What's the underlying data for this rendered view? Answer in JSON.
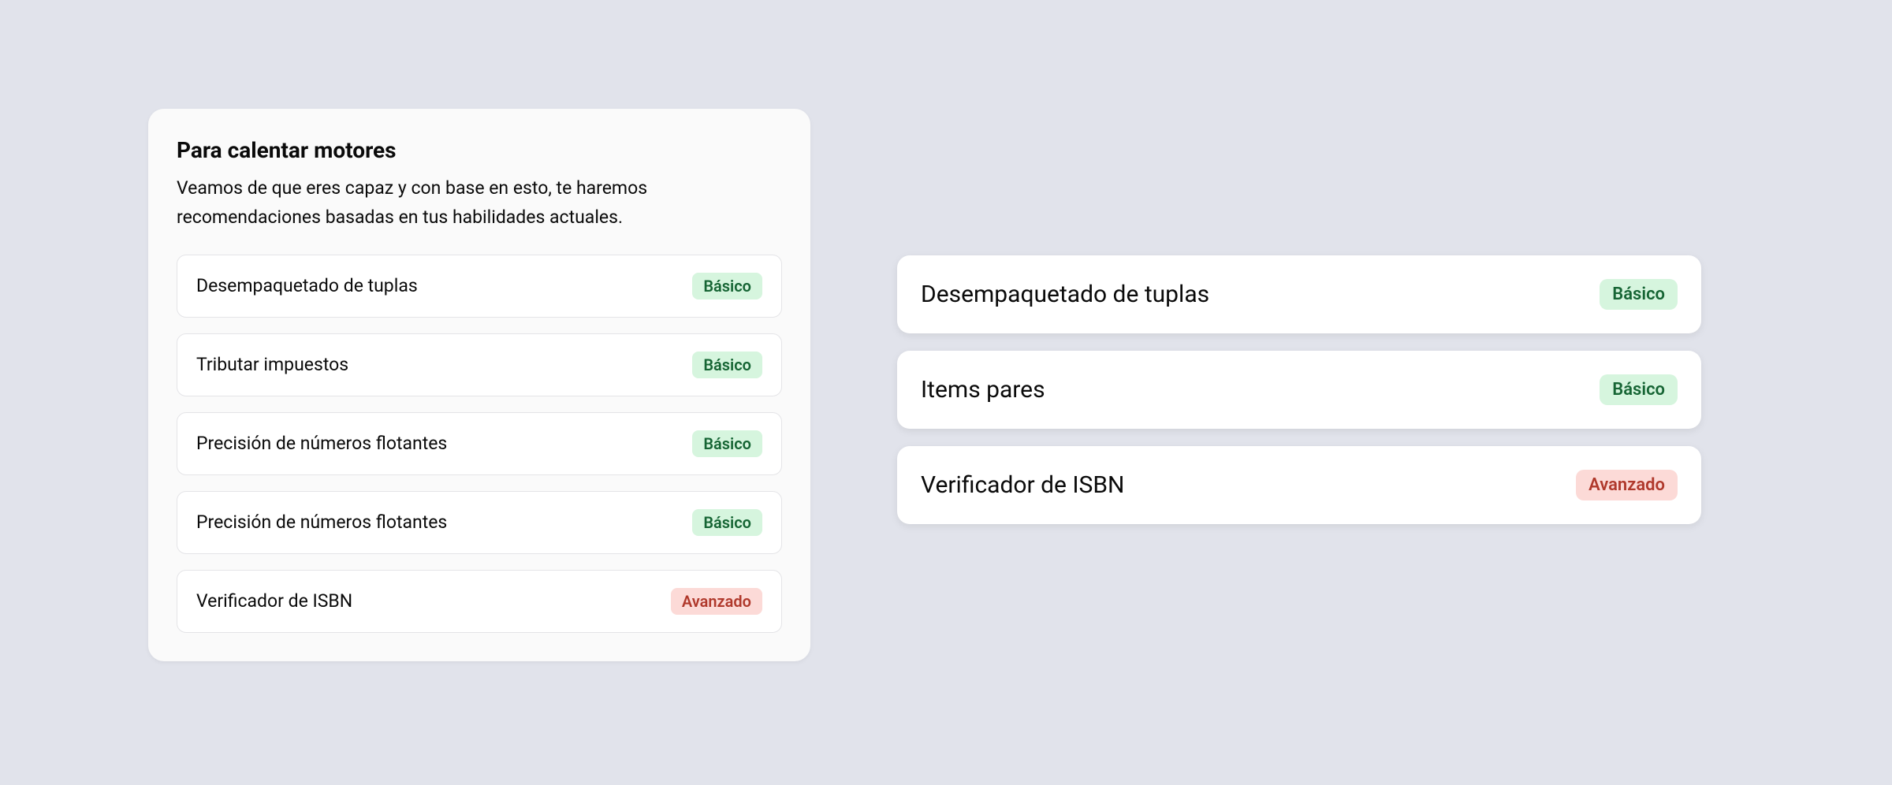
{
  "panel": {
    "title": "Para calentar motores",
    "description": "Veamos de que eres capaz y con base en esto, te haremos recomendaciones basadas en tus habilidades actuales.",
    "items": [
      {
        "title": "Desempaquetado de tuplas",
        "level": "Básico",
        "level_type": "basic"
      },
      {
        "title": "Tributar impuestos",
        "level": "Básico",
        "level_type": "basic"
      },
      {
        "title": "Precisión de números flotantes",
        "level": "Básico",
        "level_type": "basic"
      },
      {
        "title": "Precisión de números flotantes",
        "level": "Básico",
        "level_type": "basic"
      },
      {
        "title": "Verificador de ISBN",
        "level": "Avanzado",
        "level_type": "advanced"
      }
    ]
  },
  "right_items": [
    {
      "title": "Desempaquetado de tuplas",
      "level": "Básico",
      "level_type": "basic"
    },
    {
      "title": "Items pares",
      "level": "Básico",
      "level_type": "basic"
    },
    {
      "title": "Verificador de ISBN",
      "level": "Avanzado",
      "level_type": "advanced"
    }
  ]
}
